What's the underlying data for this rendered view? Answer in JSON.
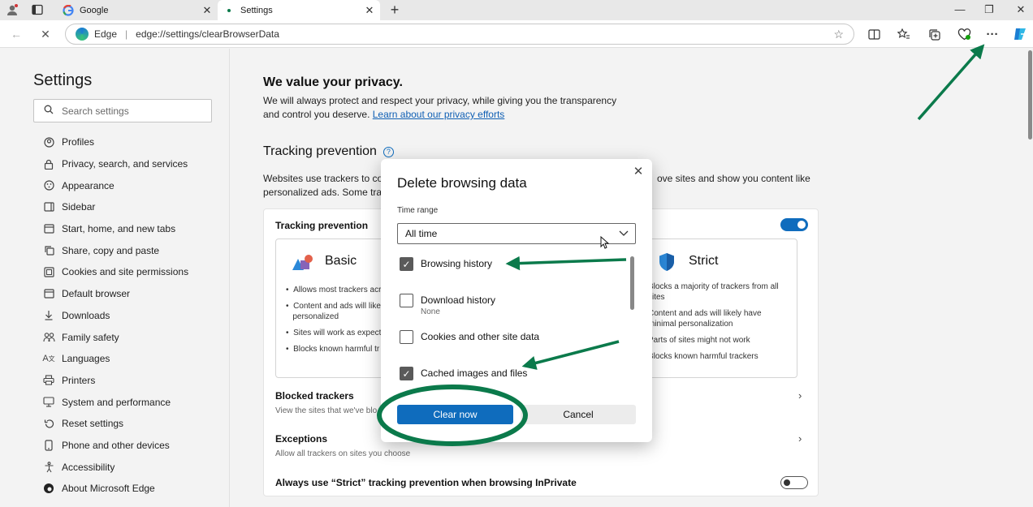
{
  "browser": {
    "tabs": [
      {
        "label": "Google",
        "favicon": "google-icon"
      },
      {
        "label": "Settings",
        "favicon": "settings-favicon"
      }
    ],
    "address_bar": {
      "site_name": "Edge",
      "separator": "|",
      "url": "edge://settings/clearBrowserData"
    }
  },
  "sidebar": {
    "title": "Settings",
    "search_placeholder": "Search settings",
    "items": [
      {
        "label": "Profiles",
        "icon": "profile-icon"
      },
      {
        "label": "Privacy, search, and services",
        "icon": "lock-icon"
      },
      {
        "label": "Appearance",
        "icon": "appearance-icon"
      },
      {
        "label": "Sidebar",
        "icon": "sidebar-icon"
      },
      {
        "label": "Start, home, and new tabs",
        "icon": "home-icon"
      },
      {
        "label": "Share, copy and paste",
        "icon": "share-icon"
      },
      {
        "label": "Cookies and site permissions",
        "icon": "cookie-icon"
      },
      {
        "label": "Default browser",
        "icon": "browser-icon"
      },
      {
        "label": "Downloads",
        "icon": "download-icon"
      },
      {
        "label": "Family safety",
        "icon": "family-icon"
      },
      {
        "label": "Languages",
        "icon": "language-icon"
      },
      {
        "label": "Printers",
        "icon": "printer-icon"
      },
      {
        "label": "System and performance",
        "icon": "system-icon"
      },
      {
        "label": "Reset settings",
        "icon": "reset-icon"
      },
      {
        "label": "Phone and other devices",
        "icon": "phone-icon"
      },
      {
        "label": "Accessibility",
        "icon": "accessibility-icon"
      },
      {
        "label": "About Microsoft Edge",
        "icon": "edge-icon"
      }
    ]
  },
  "main": {
    "privacy_title": "We value your privacy.",
    "privacy_desc_1": "We will always protect and respect your privacy, while giving you the transparency",
    "privacy_desc_2": "and control you deserve. ",
    "privacy_link": "Learn about our privacy efforts",
    "tp_heading": "Tracking prevention",
    "tp_desc_1": "Websites use trackers to coll",
    "tp_desc_1b": "ove sites and show you content like",
    "tp_desc_2": "personalized ads. Some trac",
    "card": {
      "title": "Tracking prevention",
      "enabled": true,
      "basic": {
        "name": "Basic",
        "bullets": [
          "Allows most trackers acr",
          "Content and ads will like",
          "personalized",
          "Sites will work as expect",
          "Blocks known harmful tr"
        ]
      },
      "strict": {
        "name": "Strict",
        "bullets": [
          "Blocks a majority of trackers from all sites",
          "Content and ads will likely have minimal personalization",
          "Parts of sites might not work",
          "Blocks known harmful trackers"
        ]
      },
      "blocked_title": "Blocked trackers",
      "blocked_sub": "View the sites that we've blo",
      "exceptions_title": "Exceptions",
      "exceptions_sub": "Allow all trackers on sites you choose",
      "inprivate_label": "Always use “Strict” tracking prevention when browsing InPrivate",
      "inprivate_enabled": false
    }
  },
  "dialog": {
    "title": "Delete browsing data",
    "time_range_label": "Time range",
    "time_range_value": "All time",
    "options": [
      {
        "label": "Browsing history",
        "checked": true,
        "sub": ""
      },
      {
        "label": "Download history",
        "checked": false,
        "sub": "None"
      },
      {
        "label": "Cookies and other site data",
        "checked": false,
        "sub": ""
      },
      {
        "label": "Cached images and files",
        "checked": true,
        "sub": ""
      }
    ],
    "primary_button": "Clear now",
    "secondary_button": "Cancel"
  },
  "colors": {
    "accent": "#0f6cbd",
    "annotation": "#0b7a4b"
  }
}
